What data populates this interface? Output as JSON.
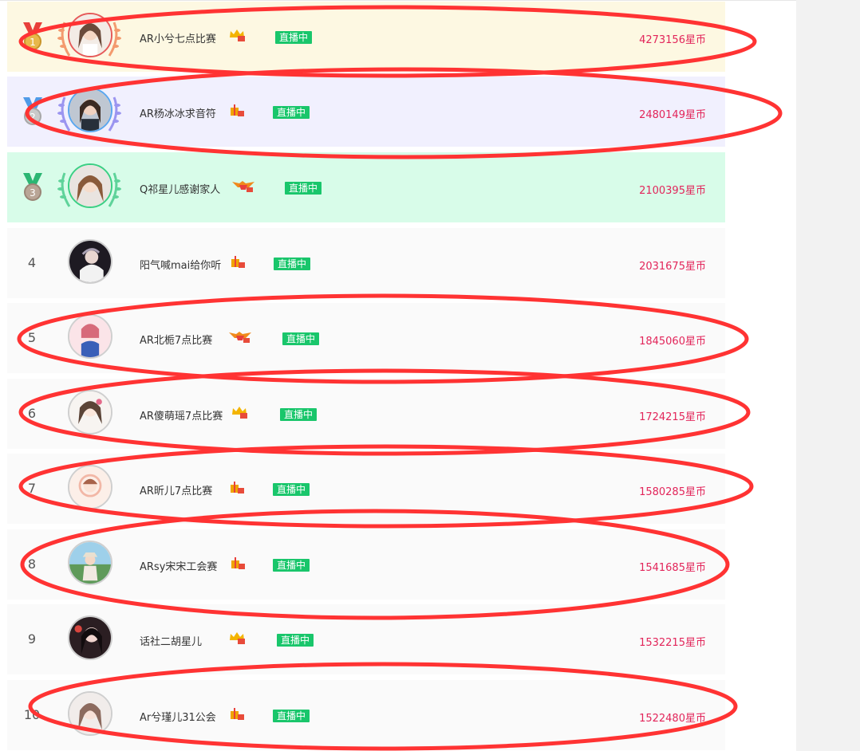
{
  "coin_unit": "星币",
  "live_label": "直播中",
  "colors": {
    "rank1_bg": "#fdf8e2",
    "rank2_bg": "#f1f0fe",
    "rank3_bg": "#d8fce9",
    "row_bg": "#fafafa",
    "coin_text": "#e2255a",
    "live_badge": "#19c66b",
    "annotation_ellipse": "#ff3333"
  },
  "rows": [
    {
      "rank": "1",
      "name": "AR小兮七点比赛",
      "coins": "4273156",
      "level_icon": "crown-level-icon",
      "live": true
    },
    {
      "rank": "2",
      "name": "AR杨冰冰求音符",
      "coins": "2480149",
      "level_icon": "gift-level-icon",
      "live": true
    },
    {
      "rank": "3",
      "name": "Q祁星儿感谢家人",
      "coins": "2100395",
      "level_icon": "wing-level-icon",
      "live": true
    },
    {
      "rank": "4",
      "name": "阳气喊mai给你听",
      "coins": "2031675",
      "level_icon": "gift-level-icon",
      "live": true
    },
    {
      "rank": "5",
      "name": "AR北栀7点比赛",
      "coins": "1845060",
      "level_icon": "wing-level-icon",
      "live": true
    },
    {
      "rank": "6",
      "name": "AR傻萌瑶7点比赛",
      "coins": "1724215",
      "level_icon": "crown-level-icon",
      "live": true
    },
    {
      "rank": "7",
      "name": "AR昕儿7点比赛",
      "coins": "1580285",
      "level_icon": "gift-level-icon",
      "live": true
    },
    {
      "rank": "8",
      "name": "ARsy宋宋工会赛",
      "coins": "1541685",
      "level_icon": "gift-level-icon",
      "live": true
    },
    {
      "rank": "9",
      "name": "话社二胡星儿",
      "coins": "1532215",
      "level_icon": "crown-level-icon",
      "live": true
    },
    {
      "rank": "10",
      "name": "Ar兮瑾儿31公会",
      "coins": "1522480",
      "level_icon": "gift-level-icon",
      "live": true
    }
  ]
}
